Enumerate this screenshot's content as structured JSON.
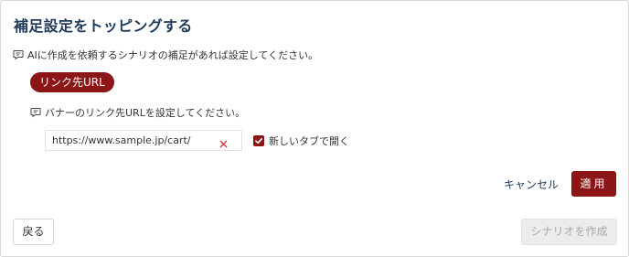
{
  "dialog": {
    "title": "補足設定をトッピングする",
    "hint": "AIに作成を依頼するシナリオの補足があれば設定してください。",
    "tag_label": "リンク先URL",
    "url_hint": "バナーのリンク先URLを設定してください。",
    "url_input": {
      "value": "https://www.sample.jp/cart/",
      "clear_icon": "close-icon"
    },
    "new_tab_checkbox": {
      "label": "新しいタブで開く",
      "checked": true
    },
    "cancel_label": "キャンセル",
    "apply_label": "適用",
    "back_label": "戻る",
    "create_label": "シナリオを作成"
  },
  "colors": {
    "accent": "#8c1616",
    "title": "#1f3a5a",
    "disabled_bg": "#ececec",
    "disabled_text": "#a8a8a8"
  },
  "icons": {
    "hint": "comment-icon",
    "clear": "close-icon",
    "check": "check-icon"
  }
}
